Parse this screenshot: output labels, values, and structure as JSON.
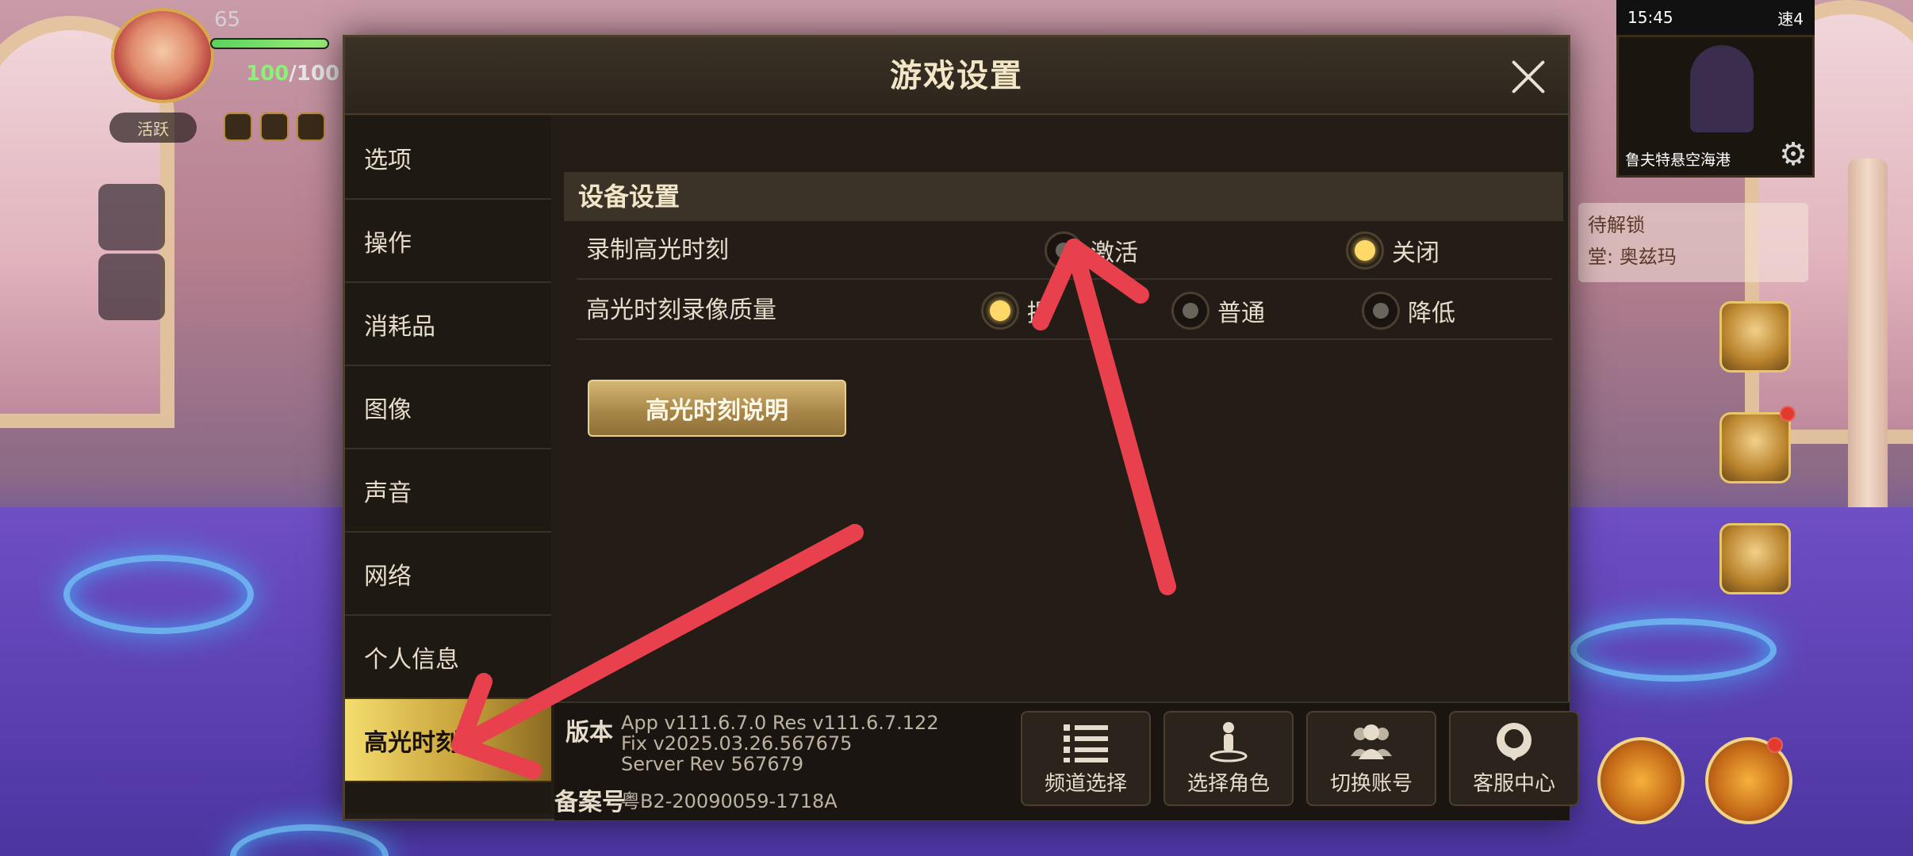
{
  "hud": {
    "level": "65",
    "hp": "100",
    "hp_max": "/100",
    "online_label": "活跃"
  },
  "status_bar": {
    "time": "15:45",
    "carrier": "速4"
  },
  "minimap": {
    "location": "鲁夫特悬空海港"
  },
  "quest": {
    "line1": "待解锁",
    "line2": "堂: 奥兹玛"
  },
  "dialog": {
    "title": "游戏设置",
    "sidebar": [
      {
        "label": "选项"
      },
      {
        "label": "操作"
      },
      {
        "label": "消耗品"
      },
      {
        "label": "图像"
      },
      {
        "label": "声音"
      },
      {
        "label": "网络"
      },
      {
        "label": "个人信息"
      },
      {
        "label": "高光时刻"
      }
    ],
    "active_tab": "高光时刻",
    "section_title": "设备设置",
    "rows": [
      {
        "label": "录制高光时刻",
        "options": [
          {
            "label": "激活",
            "selected": false
          },
          {
            "label": "关闭",
            "selected": true
          }
        ]
      },
      {
        "label": "高光时刻录像质量",
        "options": [
          {
            "label": "提",
            "selected": true
          },
          {
            "label": "普通",
            "selected": false
          },
          {
            "label": "降低",
            "selected": false
          }
        ]
      }
    ],
    "explain_button": "高光时刻说明",
    "footer": {
      "version_label": "版本",
      "version_lines": [
        "App v111.6.7.0 Res v111.6.7.122",
        "Fix v2025.03.26.567675",
        "Server Rev 567679"
      ],
      "icp_label": "备案号",
      "icp_value": "粤B2-20090059-1718A",
      "buttons": [
        {
          "label": "频道选择",
          "icon": "list-icon"
        },
        {
          "label": "选择角色",
          "icon": "character-icon"
        },
        {
          "label": "切换账号",
          "icon": "users-icon"
        },
        {
          "label": "客服中心",
          "icon": "support-icon"
        }
      ]
    }
  },
  "colors": {
    "accent_gold": "#ffd86a",
    "active_tab": "#c9a43c",
    "arrow_red": "#e8404c"
  }
}
